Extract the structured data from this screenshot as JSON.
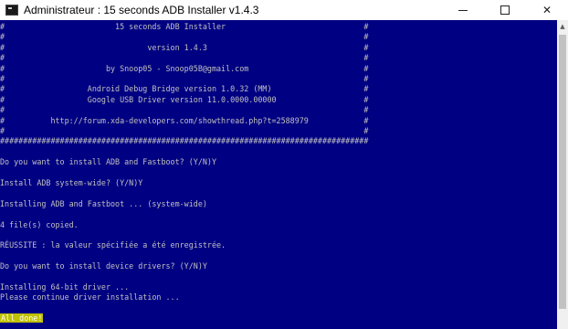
{
  "window": {
    "title": "Administrateur :  15 seconds ADB Installer v1.4.3",
    "minimize_icon": "minimize-icon",
    "maximize_icon": "maximize-icon",
    "close_glyph": "✕"
  },
  "console": {
    "lines": [
      "#                        15 seconds ADB Installer                              #",
      "#                                                                              #",
      "#                               version 1.4.3                                  #",
      "#                                                                              #",
      "#                      by Snoop05 - Snoop05B@gmail.com                         #",
      "#                                                                              #",
      "#                  Android Debug Bridge version 1.0.32 (MM)                    #",
      "#                  Google USB Driver version 11.0.0000.00000                   #",
      "#                                                                              #",
      "#          http://forum.xda-developers.com/showthread.php?t=2588979            #",
      "#                                                                              #",
      "################################################################################",
      "",
      "Do you want to install ADB and Fastboot? (Y/N)Y",
      "",
      "Install ADB system-wide? (Y/N)Y",
      "",
      "Installing ADB and Fastboot ... (system-wide)",
      "",
      "4 file(s) copied.",
      "",
      "RÉUSSITE : la valeur spécifiée a été enregistrée.",
      "",
      "Do you want to install device drivers? (Y/N)Y",
      "",
      "Installing 64-bit driver ...",
      "Please continue driver installation ...",
      ""
    ],
    "final_message": "All done!"
  }
}
